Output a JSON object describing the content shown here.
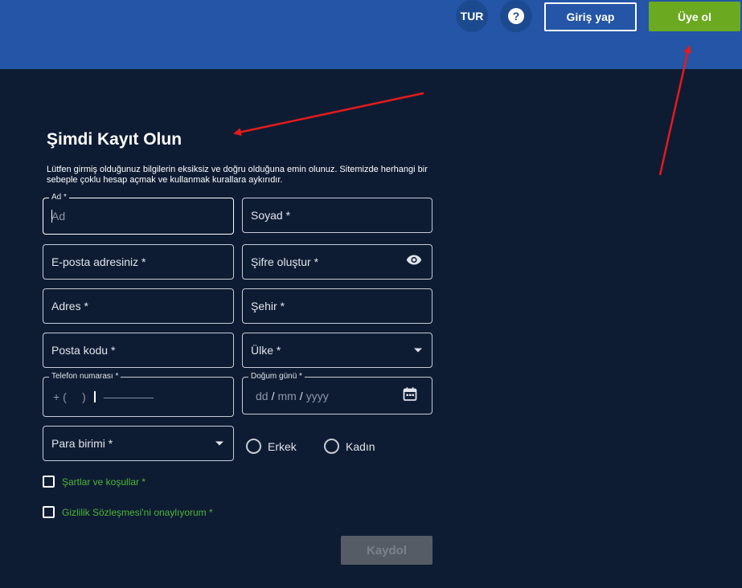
{
  "header": {
    "language": "TUR",
    "help_symbol": "?",
    "login_label": "Giriş yap",
    "signup_label": "Üye ol"
  },
  "form": {
    "title": "Şimdi Kayıt Olun",
    "description": "Lütfen girmiş olduğunuz bilgilerin eksiksiz ve doğru olduğuna emin olunuz. Sitemizde herhangi bir sebeple çoklu hesap açmak ve kullanmak kurallara aykırıdır.",
    "first_name": {
      "label": "Ad *",
      "placeholder": "Ad"
    },
    "last_name": {
      "label": "Soyad *"
    },
    "email": {
      "label": "E-posta adresiniz *"
    },
    "password": {
      "label": "Şifre oluştur *"
    },
    "address": {
      "label": "Adres *"
    },
    "city": {
      "label": "Şehir *"
    },
    "postal_code": {
      "label": "Posta kodu *"
    },
    "country": {
      "label": "Ülke *"
    },
    "phone": {
      "label": "Telefon numarası *",
      "code_placeholder": "+ (     )",
      "number_placeholder": "––––––––"
    },
    "birthdate": {
      "label": "Doğum günü *",
      "day": "dd",
      "month": "mm",
      "year": "yyyy",
      "separator": "/"
    },
    "currency": {
      "label": "Para birimi *"
    },
    "gender": {
      "male": "Erkek",
      "female": "Kadın"
    },
    "terms": "Şartlar ve koşullar *",
    "privacy": "Gizlilik Sözleşmesi'ni onaylıyorum *",
    "submit_label": "Kaydol"
  },
  "colors": {
    "header_bg": "#2455a6",
    "page_bg": "#0e1c33",
    "signup_green": "#6aa920",
    "check_label_green": "#4db535",
    "annotation_red": "#e31b1b"
  },
  "icons": [
    "question-icon",
    "eye-icon",
    "calendar-icon",
    "chevron-down-icon"
  ]
}
